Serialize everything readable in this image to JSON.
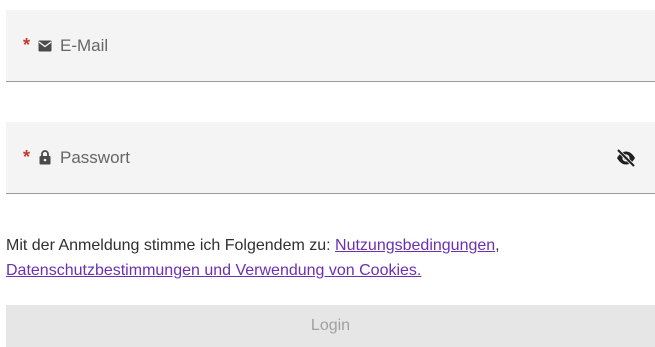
{
  "form": {
    "email": {
      "required_mark": "*",
      "icon": "envelope-icon",
      "placeholder": "E-Mail"
    },
    "password": {
      "required_mark": "*",
      "icon": "lock-icon",
      "placeholder": "Passwort",
      "visibility_icon": "eye-slash-icon"
    },
    "consent": {
      "text": "Mit der Anmeldung stimme ich Folgendem zu: ",
      "link_terms": "Nutzungsbedingungen",
      "separator": ", ",
      "link_privacy": "Datenschutzbestimmungen und Verwendung von Cookies."
    },
    "login_button": "Login"
  },
  "colors": {
    "required": "#c0392b",
    "link": "#6b2fb3",
    "field_bg": "#f4f4f4",
    "button_disabled_bg": "#e6e6e6",
    "button_disabled_text": "#a0a0a0"
  }
}
